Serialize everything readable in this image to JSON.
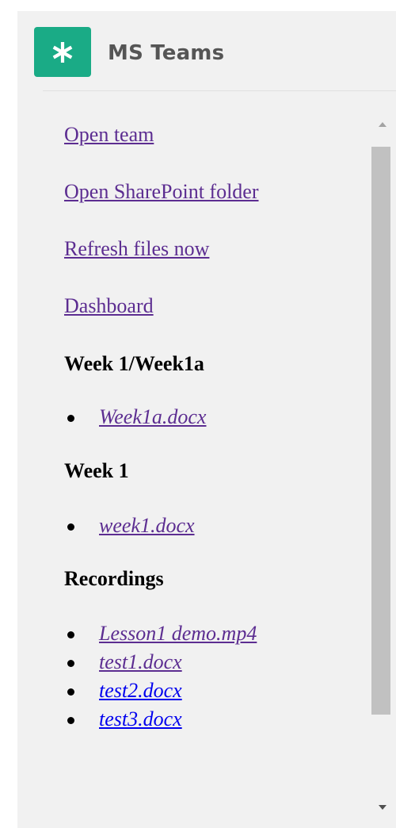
{
  "header": {
    "app_name": "MS Teams",
    "logo_icon": "asterisk-icon",
    "logo_color": "#1aab86"
  },
  "nav_links": [
    {
      "label": "Open team"
    },
    {
      "label": "Open SharePoint folder"
    },
    {
      "label": "Refresh files now"
    },
    {
      "label": "Dashboard"
    }
  ],
  "sections": [
    {
      "heading": "Week 1/Week1a",
      "files": [
        {
          "name": "Week1a.docx",
          "visited": true
        }
      ]
    },
    {
      "heading": "Week 1",
      "files": [
        {
          "name": "week1.docx",
          "visited": true
        }
      ]
    },
    {
      "heading": "Recordings",
      "files": [
        {
          "name": "Lesson1 demo.mp4",
          "visited": true
        },
        {
          "name": "test1.docx",
          "visited": true
        },
        {
          "name": "test2.docx",
          "visited": false
        },
        {
          "name": "test3.docx",
          "visited": false
        }
      ]
    }
  ],
  "colors": {
    "visited_link": "#5c2d91",
    "unvisited_link": "#0000ee",
    "panel_background": "#f1f1f1"
  },
  "scrollbar": {
    "up_icon": "scroll-up-arrow-icon",
    "down_icon": "scroll-down-arrow-icon"
  }
}
